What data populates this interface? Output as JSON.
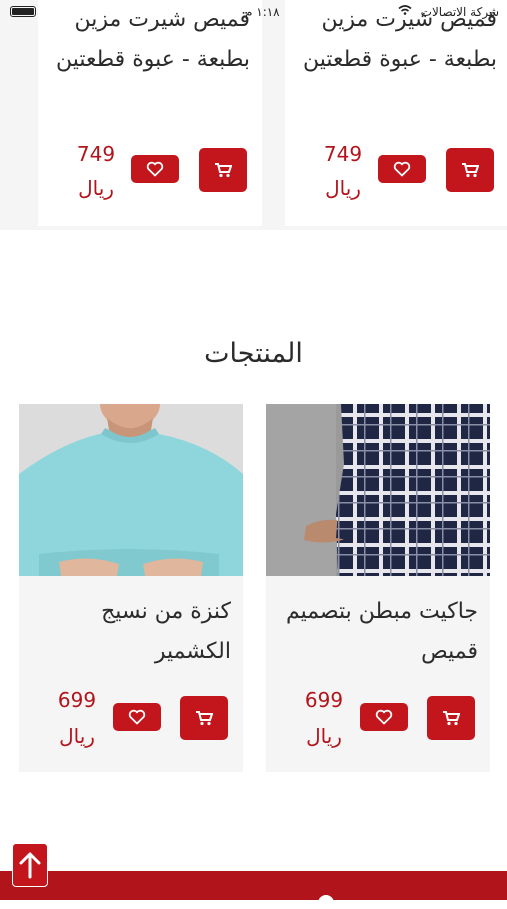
{
  "status_bar": {
    "carrier": "شركة الاتصالات",
    "time": "١:١٨ م"
  },
  "top_products": [
    {
      "title": "قميص شيرت مزين بطبعة - عبوة قطعتين",
      "price": "749",
      "currency": "ريال"
    },
    {
      "title": "قميص شيرت مزين بطبعة - عبوة قطعتين",
      "price": "749",
      "currency": "ريال"
    }
  ],
  "section": {
    "title": "المنتجات"
  },
  "products": [
    {
      "title": "جاكيت مبطن بتصميم قميص",
      "price": "699",
      "currency": "ريال"
    },
    {
      "title": "كنزة من نسيج الكشمير",
      "price": "699",
      "currency": "ريال"
    }
  ],
  "colors": {
    "accent": "#c3161c",
    "price": "#b2141c",
    "card_bg": "#f5f5f5"
  },
  "icons": {
    "cart": "cart-icon",
    "wishlist": "heart-icon",
    "scroll_top": "arrow-up-icon"
  }
}
